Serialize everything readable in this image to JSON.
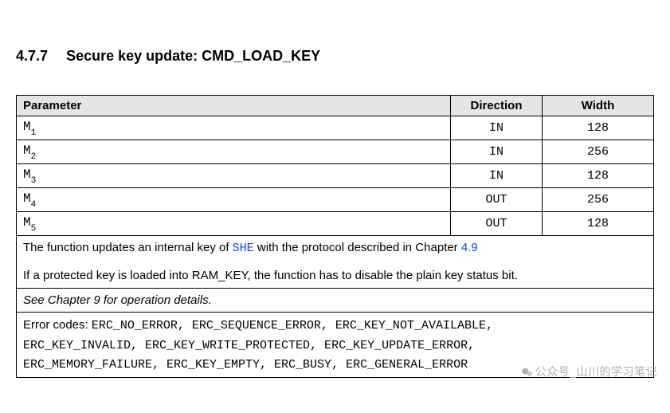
{
  "section": {
    "number": "4.7.7",
    "title": "Secure key update: CMD_LOAD_KEY"
  },
  "table": {
    "headers": {
      "param": "Parameter",
      "direction": "Direction",
      "width": "Width"
    },
    "rows": [
      {
        "base": "M",
        "sub": "1",
        "direction": "IN",
        "width": "128"
      },
      {
        "base": "M",
        "sub": "2",
        "direction": "IN",
        "width": "256"
      },
      {
        "base": "M",
        "sub": "3",
        "direction": "IN",
        "width": "128"
      },
      {
        "base": "M",
        "sub": "4",
        "direction": "OUT",
        "width": "256"
      },
      {
        "base": "M",
        "sub": "5",
        "direction": "OUT",
        "width": "128"
      }
    ],
    "desc1": {
      "pre": "The function updates an internal key of ",
      "she": "SHE",
      "mid": " with the protocol described in Chapter ",
      "chapter_ref": "4.9"
    },
    "desc2": "If a protected key is loaded into RAM_KEY, the function has to disable the plain key status bit.",
    "see_chapter": "See Chapter 9 for operation details.",
    "errors": {
      "label": "Error codes: ",
      "list_line1": "ERC_NO_ERROR, ERC_SEQUENCE_ERROR, ERC_KEY_NOT_AVAILABLE,",
      "list_line2": "ERC_KEY_INVALID, ERC_KEY_WRITE_PROTECTED, ERC_KEY_UPDATE_ERROR,",
      "list_line3": "ERC_MEMORY_FAILURE, ERC_KEY_EMPTY, ERC_BUSY, ERC_GENERAL_ERROR"
    }
  },
  "watermark": "公众号_山川的学习笔记"
}
